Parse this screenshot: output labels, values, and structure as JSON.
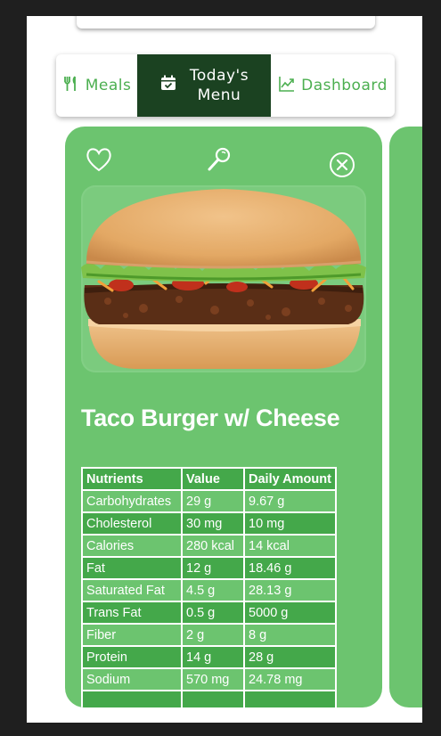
{
  "tabs": [
    {
      "label": "Meals",
      "icon": "utensils-icon"
    },
    {
      "label": "Today's\nMenu",
      "line1": "Today's",
      "line2": "Menu",
      "icon": "calendar-check-icon"
    },
    {
      "label": "Dashboard",
      "icon": "trend-chart-icon"
    }
  ],
  "card": {
    "title": "Taco Burger w/ Cheese",
    "icons": [
      "heart-icon",
      "search-icon",
      "close-circle-icon"
    ]
  },
  "nutrition": {
    "headers": [
      "Nutrients",
      "Value",
      "Daily Amount"
    ],
    "rows": [
      [
        "Carbohydrates",
        "29 g",
        "9.67 g"
      ],
      [
        "Cholesterol",
        "30 mg",
        "10 mg"
      ],
      [
        "Calories",
        "280 kcal",
        "14 kcal"
      ],
      [
        "Fat",
        "12 g",
        "18.46 g"
      ],
      [
        "Saturated Fat",
        "4.5 g",
        "28.13 g"
      ],
      [
        "Trans Fat",
        "0.5 g",
        "5000 g"
      ],
      [
        "Fiber",
        "2 g",
        "8 g"
      ],
      [
        "Protein",
        "14 g",
        "28 g"
      ],
      [
        "Sodium",
        "570 mg",
        "24.78 mg"
      ]
    ]
  },
  "colors": {
    "accent": "#4caf50",
    "active_tab": "#1b4221",
    "card": "#6cc46f",
    "row_alt": "#44a84a"
  }
}
